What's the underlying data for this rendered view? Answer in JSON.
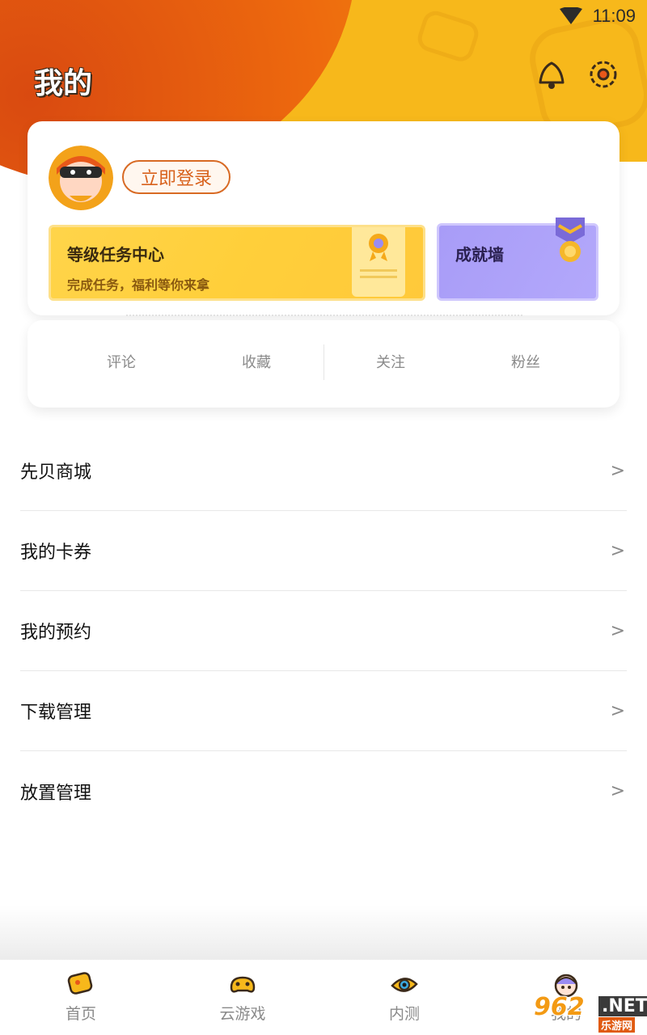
{
  "status_bar": {
    "time": "11:09"
  },
  "header": {
    "title": "我的"
  },
  "profile": {
    "login_label": "立即登录"
  },
  "task_center": {
    "title": "等级任务中心",
    "subtitle": "完成任务，福利等你来拿"
  },
  "achievement": {
    "title": "成就墙"
  },
  "stats": [
    {
      "label": "评论"
    },
    {
      "label": "收藏"
    },
    {
      "label": "关注"
    },
    {
      "label": "粉丝"
    }
  ],
  "menu": [
    {
      "label": "先贝商城"
    },
    {
      "label": "我的卡券"
    },
    {
      "label": "我的预约"
    },
    {
      "label": "下载管理"
    },
    {
      "label": "放置管理"
    }
  ],
  "bottom_nav": [
    {
      "label": "首页",
      "icon": "home-icon"
    },
    {
      "label": "云游戏",
      "icon": "cloud-game-icon"
    },
    {
      "label": "内测",
      "icon": "beta-eye-icon"
    },
    {
      "label": "我的",
      "icon": "profile-mascot-icon"
    }
  ],
  "watermark": {
    "number": "962",
    "suffix": ".NET",
    "site": "乐游网"
  },
  "colors": {
    "accent_orange": "#d8621d",
    "header_yellow": "#f7b81b",
    "task_yellow": "#ffd44a",
    "achievement_purple": "#a89cf7"
  }
}
